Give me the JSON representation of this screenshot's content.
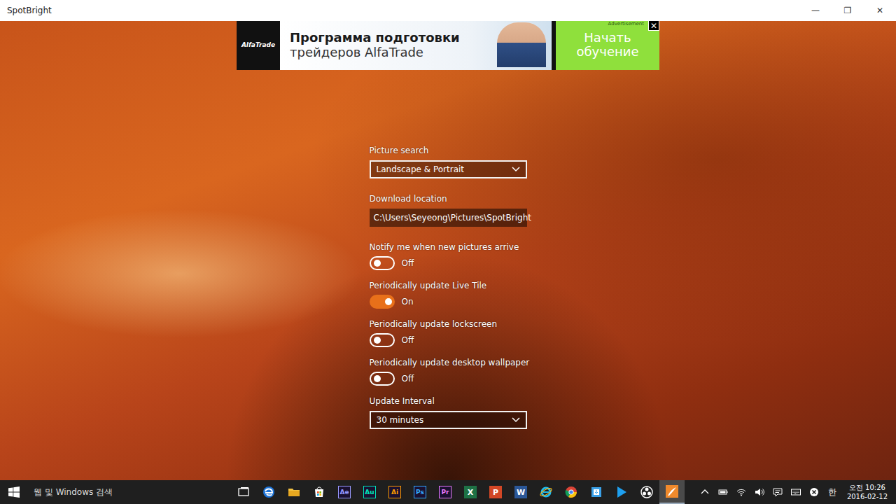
{
  "window": {
    "title": "SpotBright",
    "controls": [
      "—",
      "❐",
      "✕"
    ]
  },
  "ad": {
    "logo": "AlfaTrade",
    "line1": "Программа подготовки",
    "line2": "трейдеров AlfaTrade",
    "button": "Начать обучение",
    "tag": "Advertisement",
    "close": "✕"
  },
  "settings": [
    {
      "kind": "dropdown",
      "label": "Picture search",
      "value": "Landscape & Portrait"
    },
    {
      "kind": "path",
      "label": "Download location",
      "value": "C:\\Users\\Seyeong\\Pictures\\SpotBright"
    },
    {
      "kind": "toggle",
      "label": "Notify me when new pictures arrive",
      "on": false,
      "state": "Off"
    },
    {
      "kind": "toggle",
      "label": "Periodically update Live Tile",
      "on": true,
      "state": "On"
    },
    {
      "kind": "toggle",
      "label": "Periodically update lockscreen",
      "on": false,
      "state": "Off"
    },
    {
      "kind": "toggle",
      "label": "Periodically update desktop wallpaper",
      "on": false,
      "state": "Off"
    },
    {
      "kind": "dropdown",
      "label": "Update Interval",
      "value": "30 minutes"
    }
  ],
  "taskbar": {
    "search": "웹 및 Windows 검색",
    "apps": [
      {
        "kind": "taskview",
        "active": false
      },
      {
        "kind": "edge",
        "active": false
      },
      {
        "kind": "folder",
        "active": false
      },
      {
        "kind": "store",
        "active": false
      },
      {
        "kind": "letter",
        "label": "Ae",
        "color": "#9999ff",
        "active": false
      },
      {
        "kind": "letter",
        "label": "Au",
        "color": "#00e4bb",
        "active": false
      },
      {
        "kind": "letter",
        "label": "Ai",
        "color": "#ff9a00",
        "active": false
      },
      {
        "kind": "letter",
        "label": "Ps",
        "color": "#31a8ff",
        "active": false
      },
      {
        "kind": "letter",
        "label": "Pr",
        "color": "#e579ff",
        "active": false
      },
      {
        "kind": "office",
        "label": "X",
        "color": "#1e7145",
        "active": false
      },
      {
        "kind": "office",
        "label": "P",
        "color": "#d24726",
        "active": false
      },
      {
        "kind": "office",
        "label": "W",
        "color": "#2b5797",
        "active": false
      },
      {
        "kind": "ie",
        "active": false
      },
      {
        "kind": "chrome",
        "active": false
      },
      {
        "kind": "installer",
        "active": false
      },
      {
        "kind": "play",
        "active": false
      },
      {
        "kind": "obs",
        "active": false
      },
      {
        "kind": "spotbright",
        "active": true
      }
    ],
    "tray": {
      "ime": "한",
      "ampm": "오전",
      "time": "10:26",
      "date": "2016-02-12"
    }
  }
}
